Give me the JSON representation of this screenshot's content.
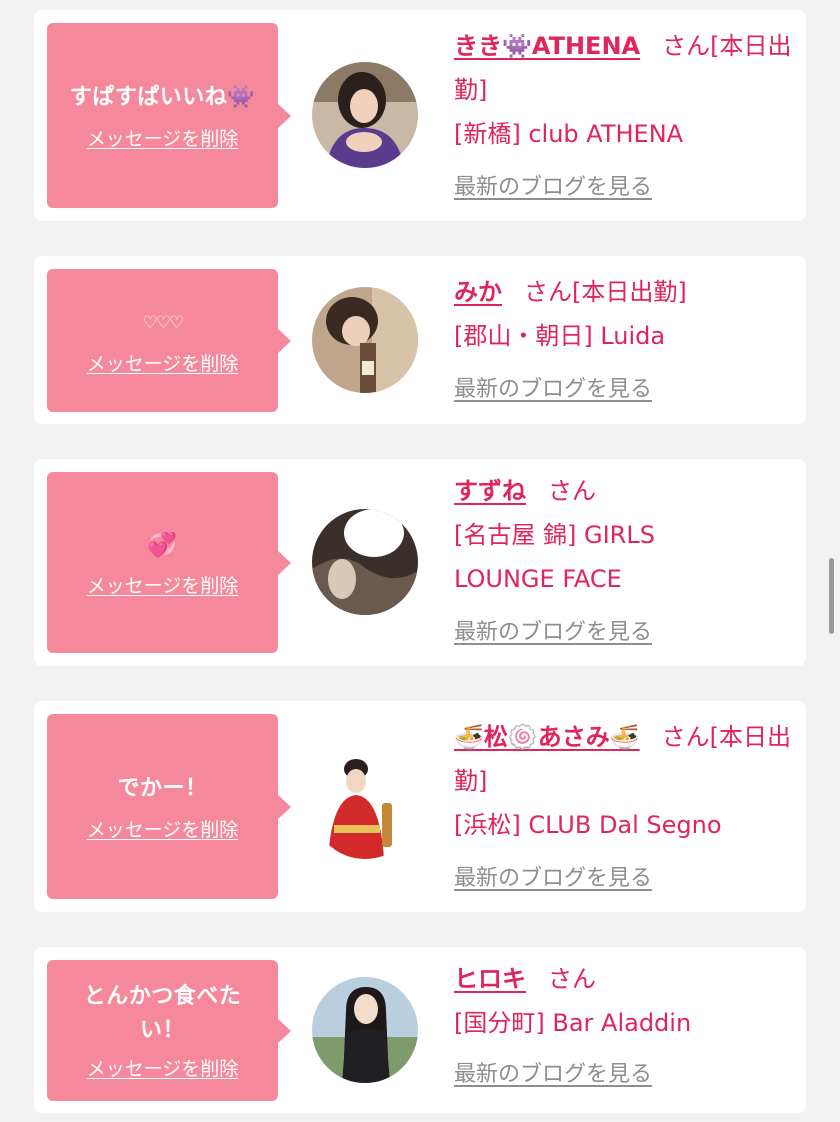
{
  "delete_label": "メッセージを削除",
  "blog_label": "最新のブログを見る",
  "san_label": "さん",
  "colors": {
    "bubble": "#f5899b",
    "accent": "#e0245c",
    "muted": "#8e8e8e",
    "background": "#f2f2f2"
  },
  "items": [
    {
      "message": "すぱすぱいいね👾",
      "name": "きき👾ATHENA",
      "status": "[本日出勤]",
      "shop": "[新橋] club ATHENA"
    },
    {
      "message": "♡♡♡",
      "name": "みか",
      "status": "[本日出勤]",
      "shop": "[郡山・朝日] Luida"
    },
    {
      "message": "💞",
      "name": "すずね",
      "status": "",
      "shop": "[名古屋 錦] GIRLS LOUNGE FACE"
    },
    {
      "message": "でかー！",
      "name": "🍜松🍥あさみ🍜",
      "status": "[本日出勤]",
      "shop": "[浜松] CLUB Dal Segno"
    },
    {
      "message": "とんかつ食べたい！",
      "name": "ヒロキ",
      "status": "",
      "shop": "[国分町] Bar Aladdin"
    }
  ]
}
